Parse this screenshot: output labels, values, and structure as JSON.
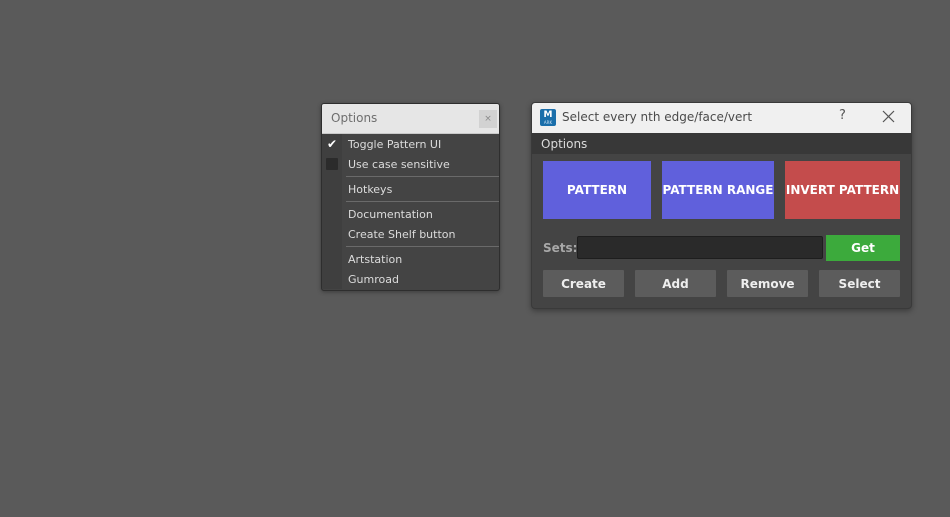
{
  "options_menu": {
    "title": "Options",
    "close_glyph": "×",
    "items": [
      {
        "label": "Toggle Pattern UI",
        "checked": true
      },
      {
        "label": "Use case sensitive",
        "checked": false
      },
      {
        "label": "Hotkeys"
      },
      {
        "label": "Documentation"
      },
      {
        "label": "Create Shelf button"
      },
      {
        "label": "Artstation"
      },
      {
        "label": "Gumroad"
      }
    ],
    "check_glyph": "✔"
  },
  "window": {
    "app_icon_letter": "M",
    "app_icon_sub": "ARK",
    "title": "Select every nth edge/face/vert",
    "help_label": "?",
    "menubar": {
      "options_label": "Options"
    },
    "buttons": {
      "pattern": "PATTERN",
      "pattern_range": "PATTERN RANGE",
      "invert_pattern": "INVERT PATTERN"
    },
    "sets": {
      "label": "Sets:",
      "value": "",
      "get_label": "Get"
    },
    "actions": {
      "create": "Create",
      "add": "Add",
      "remove": "Remove",
      "select": "Select"
    }
  },
  "colors": {
    "background": "#5a5a5a",
    "pattern_blue": "#6060dc",
    "invert_red": "#c44c4c",
    "get_green": "#3caa3c"
  }
}
